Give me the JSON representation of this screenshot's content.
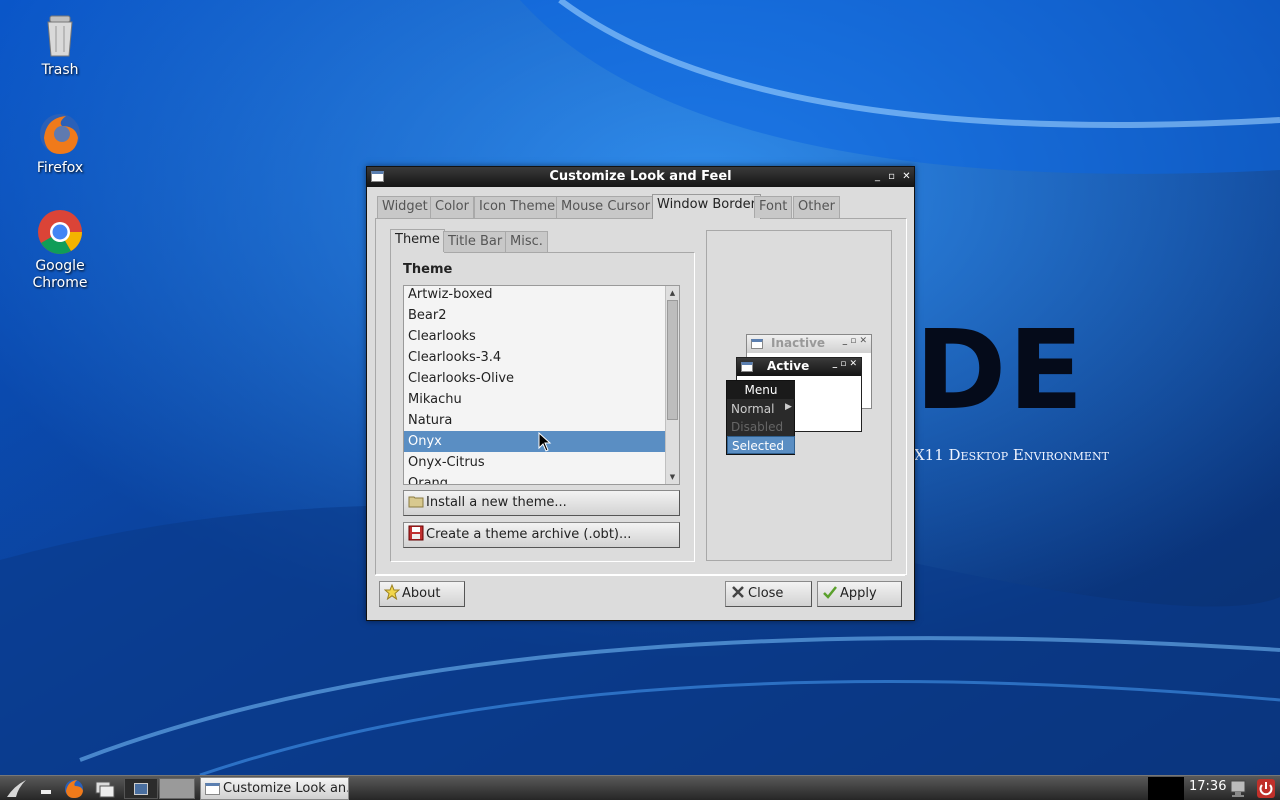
{
  "desktop": {
    "icons": [
      {
        "label": "Trash",
        "icon": "trash-icon"
      },
      {
        "label": "Firefox",
        "icon": "firefox-icon"
      },
      {
        "label": "Google Chrome",
        "icon": "chrome-icon"
      }
    ],
    "wallpaper_text": {
      "logo": "DE",
      "tagline": "X11 Desktop Environment"
    }
  },
  "window": {
    "title": "Customize Look and Feel",
    "tabs": [
      "Widget",
      "Color",
      "Icon Theme",
      "Mouse Cursor",
      "Window Border",
      "Font",
      "Other"
    ],
    "active_tab": "Window Border",
    "subtabs": [
      "Theme",
      "Title Bar",
      "Misc."
    ],
    "active_subtab": "Theme",
    "theme_heading": "Theme",
    "themes": [
      "Artwiz-boxed",
      "Bear2",
      "Clearlooks",
      "Clearlooks-3.4",
      "Clearlooks-Olive",
      "Mikachu",
      "Natura",
      "Onyx",
      "Onyx-Citrus",
      "Orang"
    ],
    "selected_theme": "Onyx",
    "install_button": "Install a new theme...",
    "archive_button": "Create a theme archive (.obt)...",
    "about_button": "About",
    "close_button": "Close",
    "apply_button": "Apply",
    "preview": {
      "inactive_title": "Inactive",
      "active_title": "Active",
      "menu_title": "Menu",
      "menu_normal": "Normal",
      "menu_disabled": "Disabled",
      "menu_selected": "Selected"
    }
  },
  "taskbar": {
    "task_label": "Customize Look an...",
    "clock": "17:36"
  },
  "colors": {
    "selection": "#5a8ec3",
    "titlebar": "#1c1c1c",
    "desktop_blue": "#0b4aa6"
  }
}
